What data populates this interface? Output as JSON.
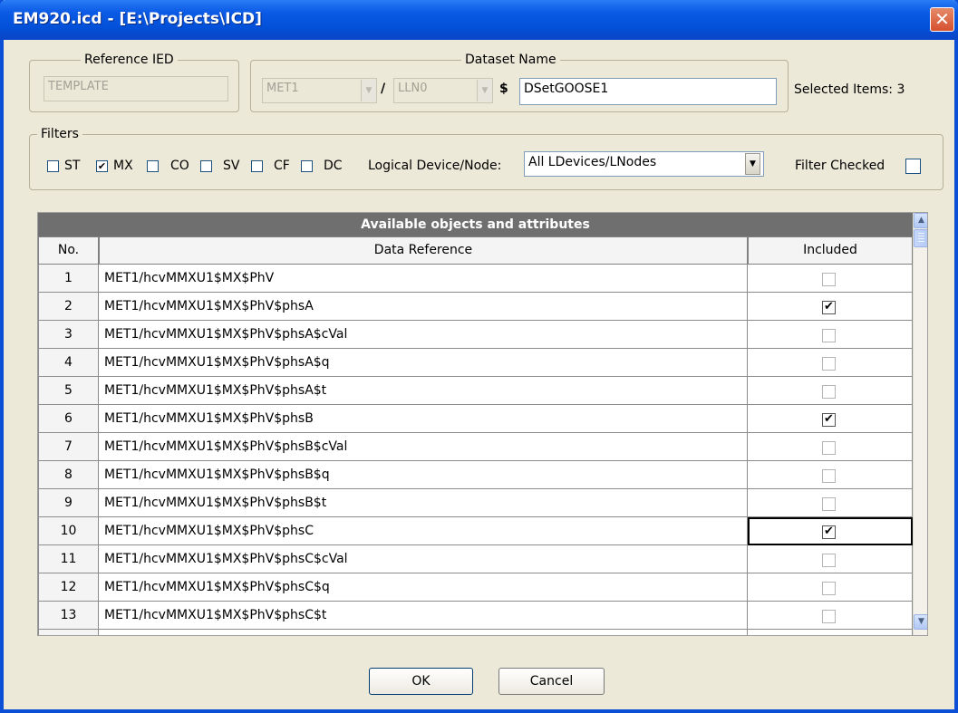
{
  "window": {
    "title": "EM920.icd - [E:\\Projects\\ICD]",
    "close_symbol": "✕"
  },
  "reference_ied": {
    "legend": "Reference IED",
    "value": "TEMPLATE"
  },
  "dataset_name": {
    "legend": "Dataset Name",
    "ld_value": "MET1",
    "slash": "/",
    "ln_value": "LLN0",
    "dollar": "$",
    "name_value": "DSetGOOSE1"
  },
  "selected_items": "Selected Items: 3",
  "filters": {
    "legend": "Filters",
    "items": [
      {
        "label": "ST",
        "checked": false
      },
      {
        "label": "MX",
        "checked": true
      },
      {
        "label": "CO",
        "checked": false
      },
      {
        "label": "SV",
        "checked": false
      },
      {
        "label": "CF",
        "checked": false
      },
      {
        "label": "DC",
        "checked": false
      }
    ],
    "ld_node_label": "Logical Device/Node:",
    "ld_node_value": "All LDevices/LNodes",
    "filter_checked_label": "Filter Checked",
    "filter_checked": false
  },
  "table": {
    "title": "Available objects and attributes",
    "columns": {
      "no": "No.",
      "ref": "Data Reference",
      "included": "Included"
    },
    "rows": [
      {
        "no": "1",
        "ref": "MET1/hcvMMXU1$MX$PhV",
        "included": false
      },
      {
        "no": "2",
        "ref": "MET1/hcvMMXU1$MX$PhV$phsA",
        "included": true
      },
      {
        "no": "3",
        "ref": "MET1/hcvMMXU1$MX$PhV$phsA$cVal",
        "included": false
      },
      {
        "no": "4",
        "ref": "MET1/hcvMMXU1$MX$PhV$phsA$q",
        "included": false
      },
      {
        "no": "5",
        "ref": "MET1/hcvMMXU1$MX$PhV$phsA$t",
        "included": false
      },
      {
        "no": "6",
        "ref": "MET1/hcvMMXU1$MX$PhV$phsB",
        "included": true
      },
      {
        "no": "7",
        "ref": "MET1/hcvMMXU1$MX$PhV$phsB$cVal",
        "included": false
      },
      {
        "no": "8",
        "ref": "MET1/hcvMMXU1$MX$PhV$phsB$q",
        "included": false
      },
      {
        "no": "9",
        "ref": "MET1/hcvMMXU1$MX$PhV$phsB$t",
        "included": false
      },
      {
        "no": "10",
        "ref": "MET1/hcvMMXU1$MX$PhV$phsC",
        "included": true,
        "focused": true
      },
      {
        "no": "11",
        "ref": "MET1/hcvMMXU1$MX$PhV$phsC$cVal",
        "included": false
      },
      {
        "no": "12",
        "ref": "MET1/hcvMMXU1$MX$PhV$phsC$q",
        "included": false
      },
      {
        "no": "13",
        "ref": "MET1/hcvMMXU1$MX$PhV$phsC$t",
        "included": false
      }
    ]
  },
  "buttons": {
    "ok": "OK",
    "cancel": "Cancel"
  },
  "icons": {
    "check": "✔",
    "combo_arrow": "▼",
    "scroll_up": "▲",
    "scroll_down": "▼"
  }
}
